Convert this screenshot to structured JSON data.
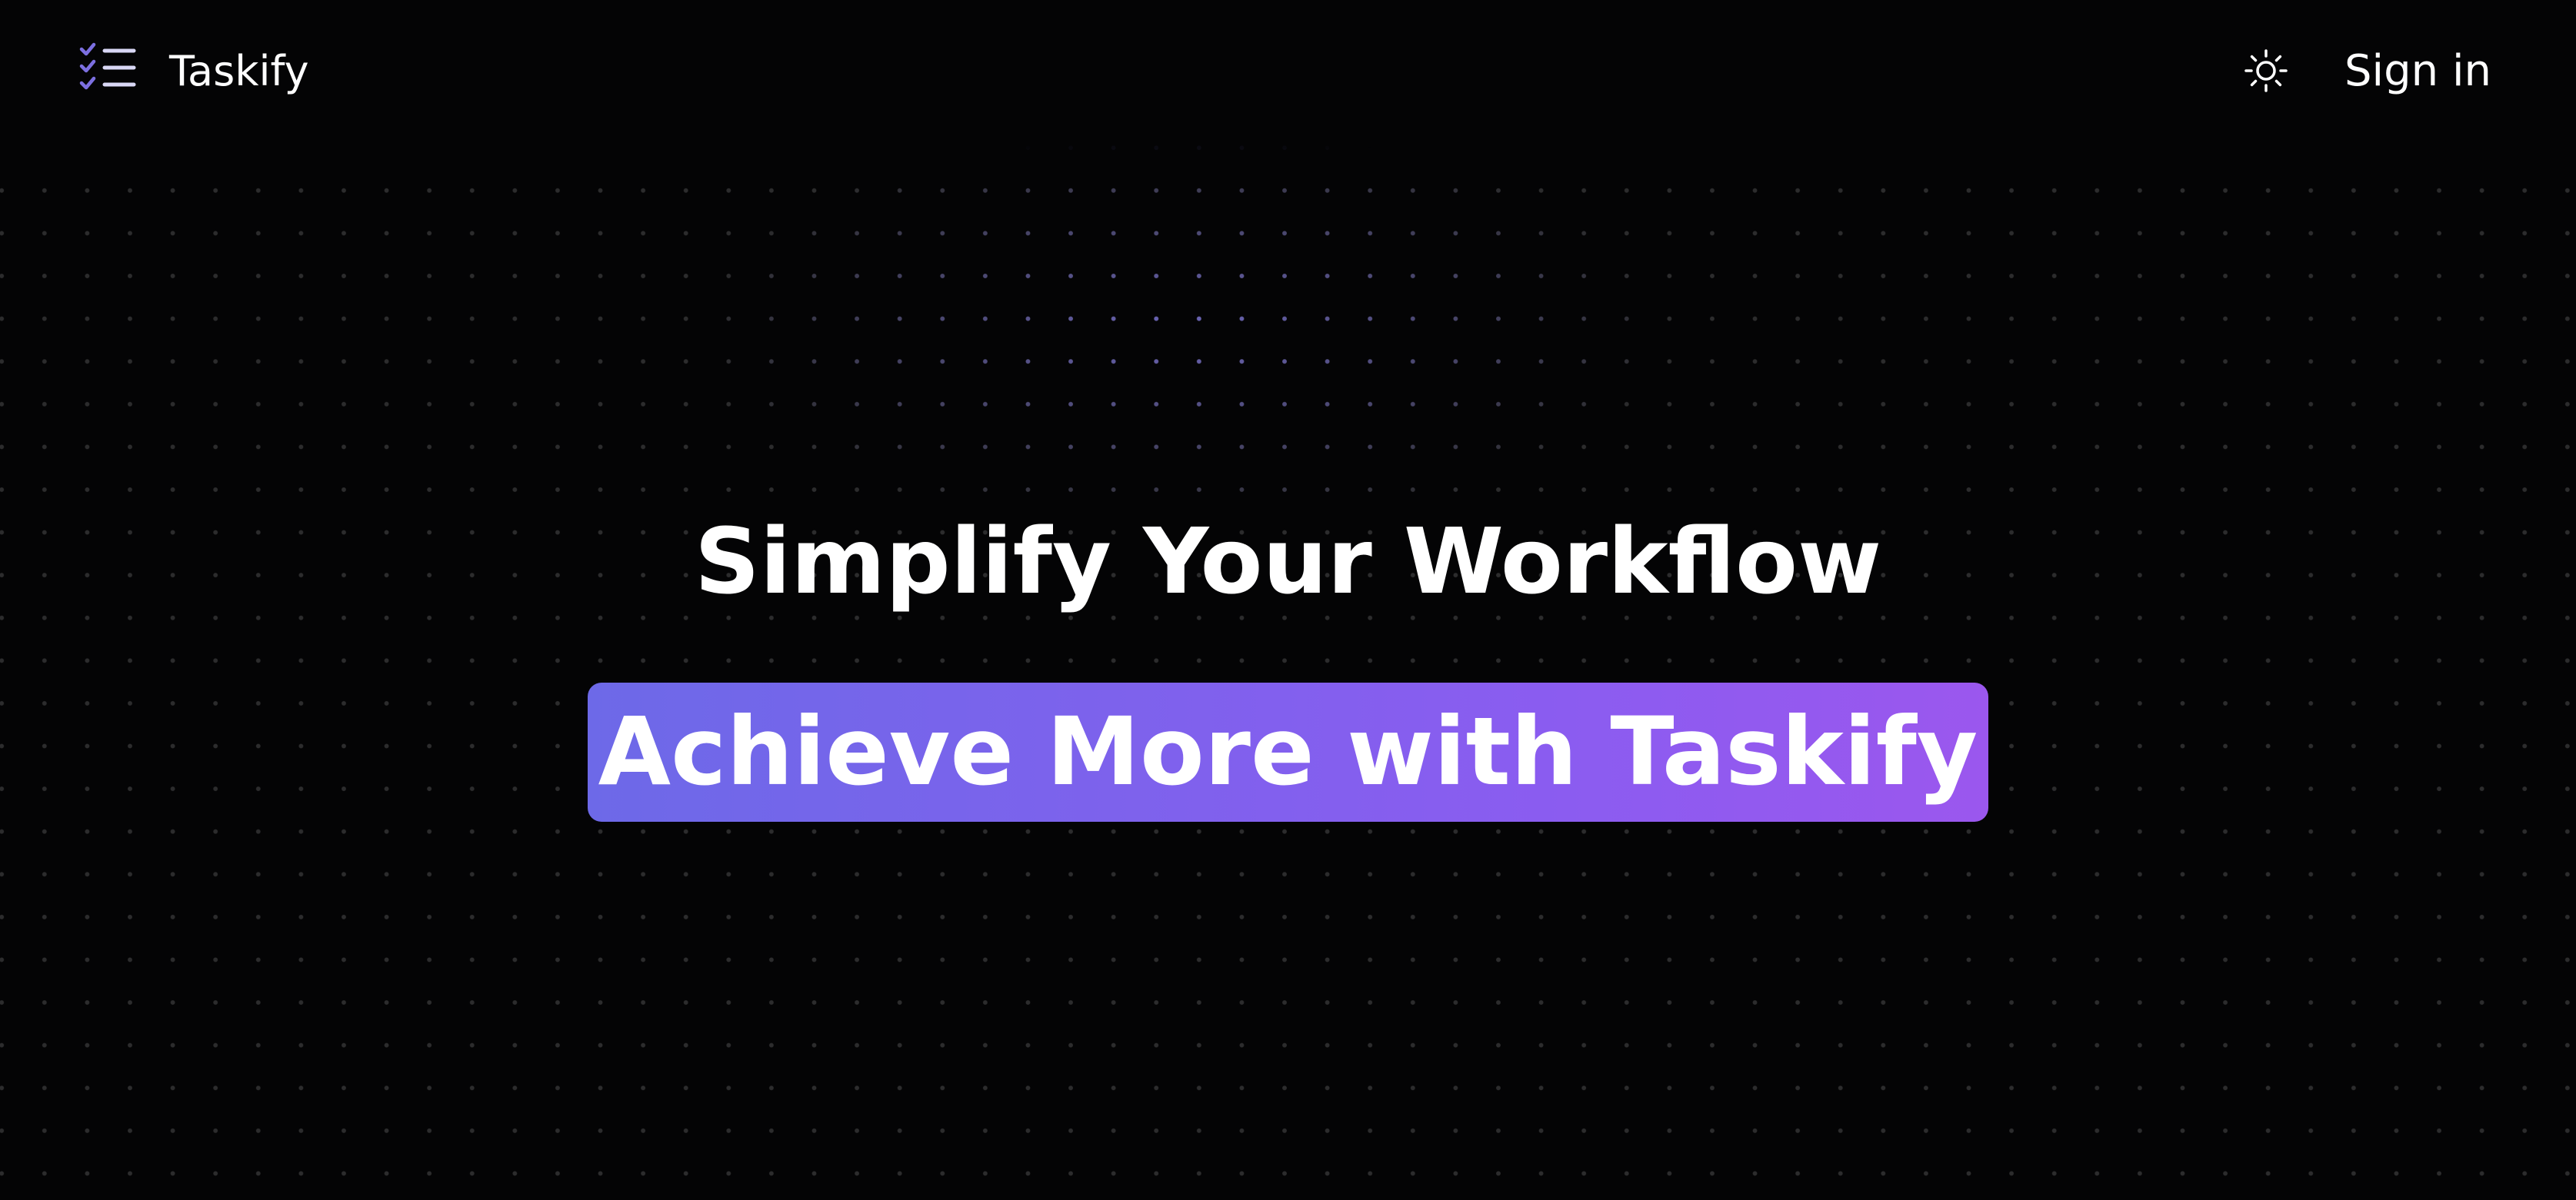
{
  "header": {
    "brand": "Taskify",
    "logo_icon": "checklist-icon",
    "theme_toggle_icon": "sun-icon",
    "signin_label": "Sign in"
  },
  "hero": {
    "title": "Simplify Your Workflow",
    "highlight": "Achieve More with Taskify"
  },
  "colors": {
    "background": "#040405",
    "accent_start": "#6d69e8",
    "accent_end": "#9b57ee",
    "logo_icon": "#7c6fe0",
    "text": "#ffffff"
  }
}
